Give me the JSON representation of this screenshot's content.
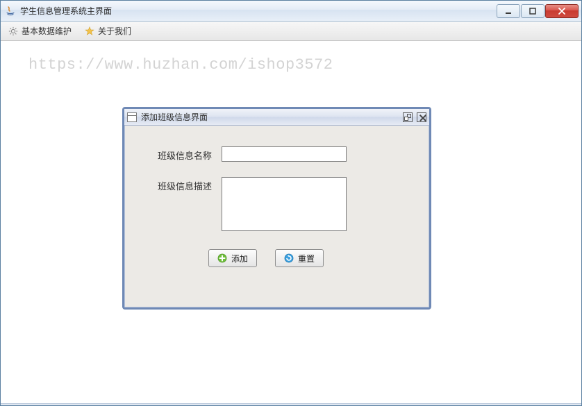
{
  "window": {
    "title": "学生信息管理系统主界面"
  },
  "menubar": {
    "items": [
      {
        "label": "基本数据维护",
        "icon": "gear-icon"
      },
      {
        "label": "关于我们",
        "icon": "star-icon"
      }
    ]
  },
  "watermark": "https://www.huzhan.com/ishop3572",
  "internalFrame": {
    "title": "添加班级信息界面",
    "fields": {
      "nameLabel": "班级信息名称",
      "nameValue": "",
      "descLabel": "班级信息描述",
      "descValue": ""
    },
    "buttons": {
      "add": "添加",
      "reset": "重置"
    }
  }
}
